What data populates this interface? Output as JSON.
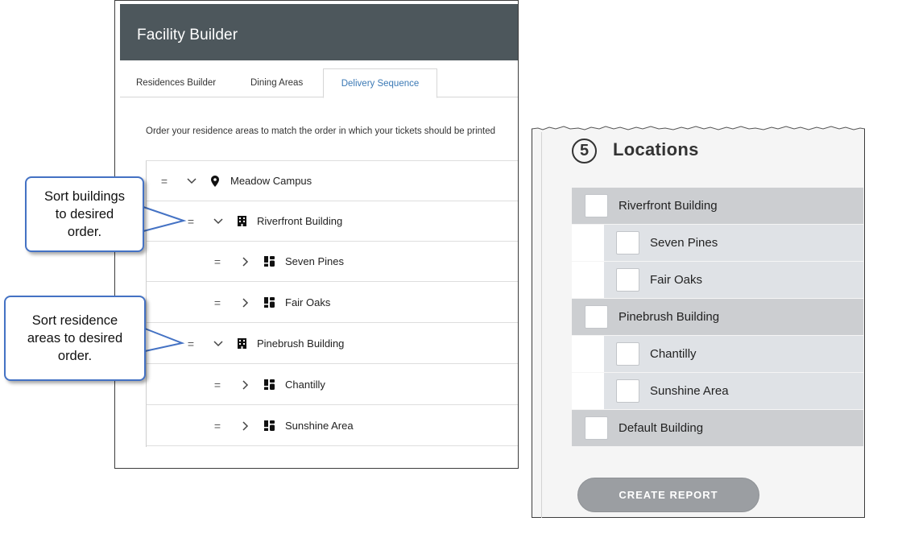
{
  "facility_builder": {
    "title": "Facility Builder",
    "tabs": [
      {
        "label": "Residences Builder",
        "active": false
      },
      {
        "label": "Dining Areas",
        "active": false
      },
      {
        "label": "Delivery Sequence",
        "active": true
      }
    ],
    "instruction": "Order your residence areas to match the order in which your tickets should be printed",
    "tree": [
      {
        "label": "Meadow Campus",
        "icon": "map-pin-icon",
        "expanded": true
      },
      {
        "label": "Riverfront Building",
        "icon": "building-icon",
        "expanded": true
      },
      {
        "label": "Seven Pines",
        "icon": "residence-area-icon",
        "expanded": false
      },
      {
        "label": "Fair Oaks",
        "icon": "residence-area-icon",
        "expanded": false
      },
      {
        "label": "Pinebrush Building",
        "icon": "building-icon",
        "expanded": true
      },
      {
        "label": "Chantilly",
        "icon": "residence-area-icon",
        "expanded": false
      },
      {
        "label": "Sunshine Area",
        "icon": "residence-area-icon",
        "expanded": false
      }
    ],
    "handle_glyph": "=",
    "active_tab_color": "#3b79b5",
    "header_color": "#4d575c"
  },
  "callouts": [
    {
      "lines": [
        "Sort buildings",
        "to desired",
        "order."
      ]
    },
    {
      "lines": [
        "Sort residence",
        "areas to desired",
        "order."
      ]
    }
  ],
  "callout_border_color": "#4472c4",
  "locations": {
    "step_number": "5",
    "title": "Locations",
    "items": [
      {
        "label": "Riverfront Building",
        "level": "building"
      },
      {
        "label": "Seven Pines",
        "level": "area"
      },
      {
        "label": "Fair Oaks",
        "level": "area"
      },
      {
        "label": "Pinebrush Building",
        "level": "building"
      },
      {
        "label": "Chantilly",
        "level": "area"
      },
      {
        "label": "Sunshine Area",
        "level": "area"
      },
      {
        "label": "Default Building",
        "level": "building"
      }
    ],
    "button_label": "CREATE REPORT"
  }
}
